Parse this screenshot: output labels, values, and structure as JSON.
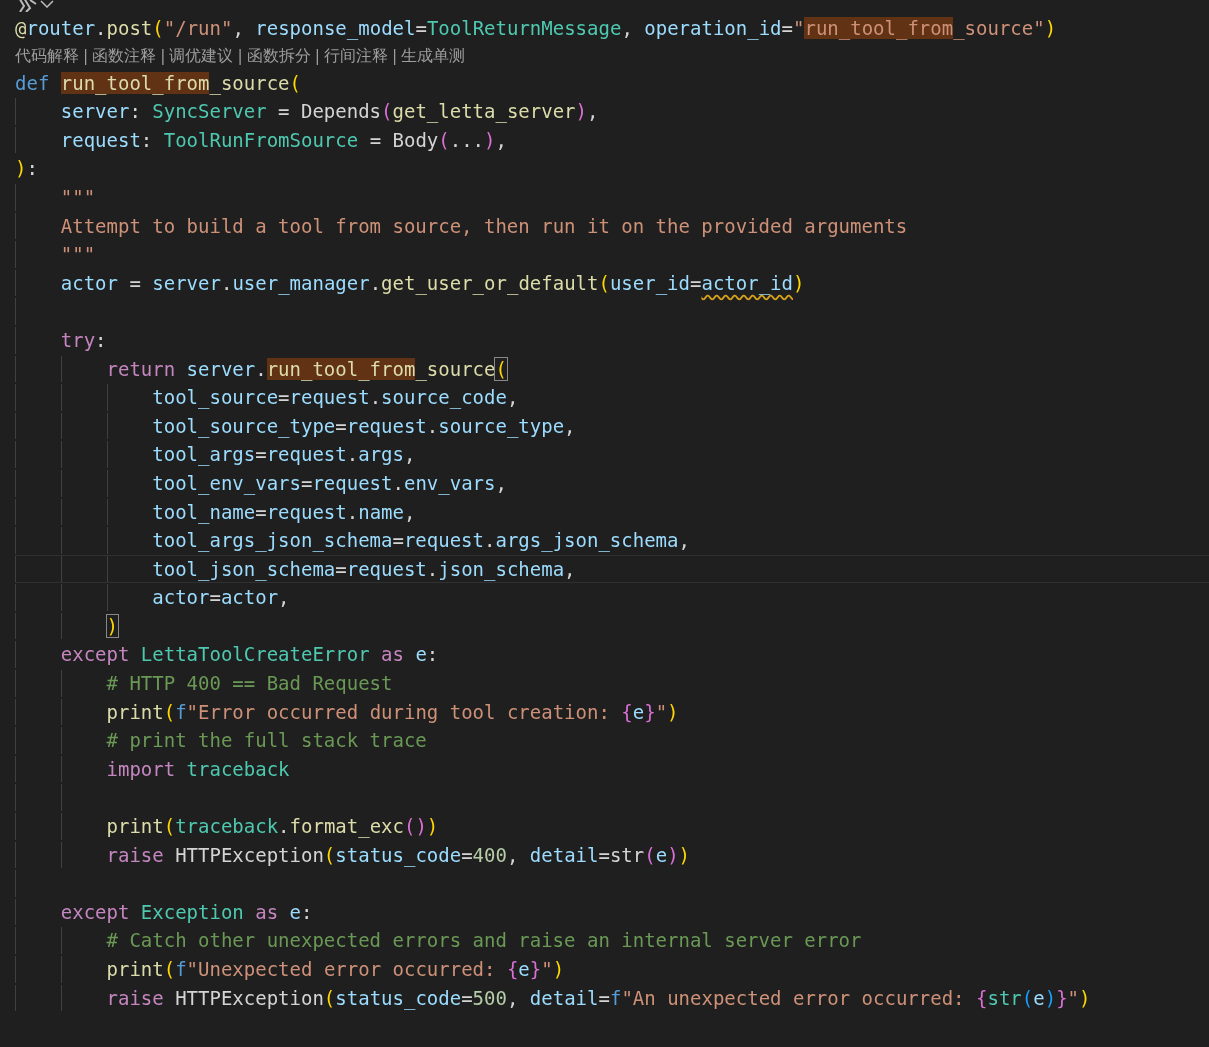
{
  "editor": {
    "lines": [
      {
        "kind": "code",
        "current": false,
        "tokens": [
          {
            "text": "@",
            "kind": "fn"
          },
          {
            "text": "router",
            "kind": "param"
          },
          {
            "text": ".",
            "kind": "plain"
          },
          {
            "text": "post",
            "kind": "fn"
          },
          {
            "text": "(",
            "kind": "br1"
          },
          {
            "text": "\"/run\"",
            "kind": "str"
          },
          {
            "text": ", ",
            "kind": "plain"
          },
          {
            "text": "response_model",
            "kind": "param"
          },
          {
            "text": "=",
            "kind": "plain"
          },
          {
            "text": "ToolReturnMessage",
            "kind": "type"
          },
          {
            "text": ", ",
            "kind": "plain"
          },
          {
            "text": "operation_id",
            "kind": "param"
          },
          {
            "text": "=",
            "kind": "plain"
          },
          {
            "text": "\"",
            "kind": "str"
          },
          {
            "text": "run_tool_from",
            "kind": "str",
            "highlight": true
          },
          {
            "text": "_source\"",
            "kind": "str"
          },
          {
            "text": ")",
            "kind": "br1"
          }
        ]
      },
      {
        "kind": "codelens",
        "separator": "|",
        "items": [
          "代码解释",
          "函数注释",
          "调优建议",
          "函数拆分",
          "行间注释",
          "生成单测"
        ]
      },
      {
        "kind": "code",
        "current": false,
        "tokens": [
          {
            "text": "def ",
            "kind": "kw"
          },
          {
            "text": "run_tool_from",
            "kind": "fn",
            "highlight": true
          },
          {
            "text": "_source",
            "kind": "fn"
          },
          {
            "text": "(",
            "kind": "br1"
          }
        ],
        "children": [
          {
            "kind": "code",
            "current": false,
            "tokens": [
              {
                "text": "server",
                "kind": "param"
              },
              {
                "text": ": ",
                "kind": "plain"
              },
              {
                "text": "SyncServer",
                "kind": "type"
              },
              {
                "text": " = Depends",
                "kind": "plain"
              },
              {
                "text": "(",
                "kind": "br2"
              },
              {
                "text": "get_letta_server",
                "kind": "fn"
              },
              {
                "text": ")",
                "kind": "br2"
              },
              {
                "text": ",",
                "kind": "plain"
              }
            ]
          },
          {
            "kind": "code",
            "current": false,
            "tokens": [
              {
                "text": "request",
                "kind": "param"
              },
              {
                "text": ": ",
                "kind": "plain"
              },
              {
                "text": "ToolRunFromSource",
                "kind": "type"
              },
              {
                "text": " = Body",
                "kind": "plain"
              },
              {
                "text": "(",
                "kind": "br2"
              },
              {
                "text": "...",
                "kind": "plain"
              },
              {
                "text": ")",
                "kind": "br2"
              },
              {
                "text": ",",
                "kind": "plain"
              }
            ]
          }
        ]
      },
      {
        "kind": "code",
        "current": false,
        "tokens": [
          {
            "text": ")",
            "kind": "br1"
          },
          {
            "text": ":",
            "kind": "plain"
          }
        ],
        "children": [
          {
            "kind": "code",
            "current": false,
            "tokens": [
              {
                "text": "\"\"\"",
                "kind": "str"
              }
            ]
          },
          {
            "kind": "code",
            "current": false,
            "tokens": [
              {
                "text": "Attempt to build a tool from source, then run it on the provided arguments",
                "kind": "str"
              }
            ]
          },
          {
            "kind": "code",
            "current": false,
            "tokens": [
              {
                "text": "\"\"\"",
                "kind": "str"
              }
            ]
          },
          {
            "kind": "code",
            "current": false,
            "tokens": [
              {
                "text": "actor",
                "kind": "param"
              },
              {
                "text": " = ",
                "kind": "plain"
              },
              {
                "text": "server",
                "kind": "param"
              },
              {
                "text": ".",
                "kind": "plain"
              },
              {
                "text": "user_manager",
                "kind": "param"
              },
              {
                "text": ".",
                "kind": "plain"
              },
              {
                "text": "get_user_or_default",
                "kind": "fn"
              },
              {
                "text": "(",
                "kind": "br1"
              },
              {
                "text": "user_id",
                "kind": "param"
              },
              {
                "text": "=",
                "kind": "plain"
              },
              {
                "text": "actor_id",
                "kind": "param",
                "squiggle": true
              },
              {
                "text": ")",
                "kind": "br1"
              }
            ]
          },
          {
            "kind": "blank"
          },
          {
            "kind": "code",
            "current": false,
            "tokens": [
              {
                "text": "try",
                "kind": "ctrl"
              },
              {
                "text": ":",
                "kind": "plain"
              }
            ],
            "children": [
              {
                "kind": "code",
                "current": false,
                "tokens": [
                  {
                    "text": "return ",
                    "kind": "ctrl"
                  },
                  {
                    "text": "server",
                    "kind": "param"
                  },
                  {
                    "text": ".",
                    "kind": "plain"
                  },
                  {
                    "text": "run_tool_from",
                    "kind": "fn",
                    "highlight": true
                  },
                  {
                    "text": "_source",
                    "kind": "fn"
                  },
                  {
                    "text": "(",
                    "kind": "br1",
                    "match": true
                  }
                ],
                "children": [
                  {
                    "kind": "code",
                    "current": false,
                    "tokens": [
                      {
                        "text": "tool_source",
                        "kind": "param"
                      },
                      {
                        "text": "=",
                        "kind": "plain"
                      },
                      {
                        "text": "request",
                        "kind": "param"
                      },
                      {
                        "text": ".",
                        "kind": "plain"
                      },
                      {
                        "text": "source_code",
                        "kind": "param"
                      },
                      {
                        "text": ",",
                        "kind": "plain"
                      }
                    ]
                  },
                  {
                    "kind": "code",
                    "current": false,
                    "tokens": [
                      {
                        "text": "tool_source_type",
                        "kind": "param"
                      },
                      {
                        "text": "=",
                        "kind": "plain"
                      },
                      {
                        "text": "request",
                        "kind": "param"
                      },
                      {
                        "text": ".",
                        "kind": "plain"
                      },
                      {
                        "text": "source_type",
                        "kind": "param"
                      },
                      {
                        "text": ",",
                        "kind": "plain"
                      }
                    ]
                  },
                  {
                    "kind": "code",
                    "current": false,
                    "tokens": [
                      {
                        "text": "tool_args",
                        "kind": "param"
                      },
                      {
                        "text": "=",
                        "kind": "plain"
                      },
                      {
                        "text": "request",
                        "kind": "param"
                      },
                      {
                        "text": ".",
                        "kind": "plain"
                      },
                      {
                        "text": "args",
                        "kind": "param"
                      },
                      {
                        "text": ",",
                        "kind": "plain"
                      }
                    ]
                  },
                  {
                    "kind": "code",
                    "current": false,
                    "tokens": [
                      {
                        "text": "tool_env_vars",
                        "kind": "param"
                      },
                      {
                        "text": "=",
                        "kind": "plain"
                      },
                      {
                        "text": "request",
                        "kind": "param"
                      },
                      {
                        "text": ".",
                        "kind": "plain"
                      },
                      {
                        "text": "env_vars",
                        "kind": "param"
                      },
                      {
                        "text": ",",
                        "kind": "plain"
                      }
                    ]
                  },
                  {
                    "kind": "code",
                    "current": false,
                    "tokens": [
                      {
                        "text": "tool_name",
                        "kind": "param"
                      },
                      {
                        "text": "=",
                        "kind": "plain"
                      },
                      {
                        "text": "request",
                        "kind": "param"
                      },
                      {
                        "text": ".",
                        "kind": "plain"
                      },
                      {
                        "text": "name",
                        "kind": "param"
                      },
                      {
                        "text": ",",
                        "kind": "plain"
                      }
                    ]
                  },
                  {
                    "kind": "code",
                    "current": false,
                    "tokens": [
                      {
                        "text": "tool_args_json_schema",
                        "kind": "param"
                      },
                      {
                        "text": "=",
                        "kind": "plain"
                      },
                      {
                        "text": "request",
                        "kind": "param"
                      },
                      {
                        "text": ".",
                        "kind": "plain"
                      },
                      {
                        "text": "args_json_schema",
                        "kind": "param"
                      },
                      {
                        "text": ",",
                        "kind": "plain"
                      }
                    ]
                  },
                  {
                    "kind": "code",
                    "current": true,
                    "tokens": [
                      {
                        "text": "tool_json_schema",
                        "kind": "param"
                      },
                      {
                        "text": "=",
                        "kind": "plain"
                      },
                      {
                        "text": "request",
                        "kind": "param"
                      },
                      {
                        "text": ".",
                        "kind": "plain"
                      },
                      {
                        "text": "json_schema",
                        "kind": "param"
                      },
                      {
                        "text": ",",
                        "kind": "plain"
                      }
                    ]
                  },
                  {
                    "kind": "code",
                    "current": false,
                    "tokens": [
                      {
                        "text": "actor",
                        "kind": "param"
                      },
                      {
                        "text": "=",
                        "kind": "plain"
                      },
                      {
                        "text": "actor",
                        "kind": "param"
                      },
                      {
                        "text": ",",
                        "kind": "plain"
                      }
                    ]
                  }
                ]
              },
              {
                "kind": "code",
                "current": false,
                "tokens": [
                  {
                    "text": ")",
                    "kind": "br1",
                    "match": true
                  }
                ]
              }
            ]
          },
          {
            "kind": "code",
            "current": false,
            "tokens": [
              {
                "text": "except ",
                "kind": "ctrl"
              },
              {
                "text": "LettaToolCreateError ",
                "kind": "type"
              },
              {
                "text": "as ",
                "kind": "ctrl"
              },
              {
                "text": "e",
                "kind": "param"
              },
              {
                "text": ":",
                "kind": "plain"
              }
            ],
            "children": [
              {
                "kind": "code",
                "current": false,
                "tokens": [
                  {
                    "text": "# HTTP 400 == Bad Request",
                    "kind": "comment"
                  }
                ]
              },
              {
                "kind": "code",
                "current": false,
                "tokens": [
                  {
                    "text": "print",
                    "kind": "fn"
                  },
                  {
                    "text": "(",
                    "kind": "br1"
                  },
                  {
                    "text": "f",
                    "kind": "kw"
                  },
                  {
                    "text": "\"Error occurred during tool creation: ",
                    "kind": "str"
                  },
                  {
                    "text": "{",
                    "kind": "br2"
                  },
                  {
                    "text": "e",
                    "kind": "param"
                  },
                  {
                    "text": "}",
                    "kind": "br2"
                  },
                  {
                    "text": "\"",
                    "kind": "str"
                  },
                  {
                    "text": ")",
                    "kind": "br1"
                  }
                ]
              },
              {
                "kind": "code",
                "current": false,
                "tokens": [
                  {
                    "text": "# print the full stack trace",
                    "kind": "comment"
                  }
                ]
              },
              {
                "kind": "code",
                "current": false,
                "tokens": [
                  {
                    "text": "import ",
                    "kind": "ctrl"
                  },
                  {
                    "text": "traceback",
                    "kind": "type"
                  }
                ]
              },
              {
                "kind": "blank"
              },
              {
                "kind": "code",
                "current": false,
                "tokens": [
                  {
                    "text": "print",
                    "kind": "fn"
                  },
                  {
                    "text": "(",
                    "kind": "br1"
                  },
                  {
                    "text": "traceback",
                    "kind": "type"
                  },
                  {
                    "text": ".",
                    "kind": "plain"
                  },
                  {
                    "text": "format_exc",
                    "kind": "fn"
                  },
                  {
                    "text": "()",
                    "kind": "br2"
                  },
                  {
                    "text": ")",
                    "kind": "br1"
                  }
                ]
              },
              {
                "kind": "code",
                "current": false,
                "tokens": [
                  {
                    "text": "raise",
                    "kind": "ctrl"
                  },
                  {
                    "text": " HTTPException",
                    "kind": "plain"
                  },
                  {
                    "text": "(",
                    "kind": "br1"
                  },
                  {
                    "text": "status_code",
                    "kind": "param"
                  },
                  {
                    "text": "=",
                    "kind": "plain"
                  },
                  {
                    "text": "400",
                    "kind": "num"
                  },
                  {
                    "text": ", ",
                    "kind": "plain"
                  },
                  {
                    "text": "detail",
                    "kind": "param"
                  },
                  {
                    "text": "=str",
                    "kind": "plain"
                  },
                  {
                    "text": "(",
                    "kind": "br2"
                  },
                  {
                    "text": "e",
                    "kind": "param"
                  },
                  {
                    "text": ")",
                    "kind": "br2"
                  },
                  {
                    "text": ")",
                    "kind": "br1"
                  }
                ]
              }
            ]
          },
          {
            "kind": "blank"
          },
          {
            "kind": "code",
            "current": false,
            "tokens": [
              {
                "text": "except ",
                "kind": "ctrl"
              },
              {
                "text": "Exception ",
                "kind": "type"
              },
              {
                "text": "as ",
                "kind": "ctrl"
              },
              {
                "text": "e",
                "kind": "param"
              },
              {
                "text": ":",
                "kind": "plain"
              }
            ],
            "children": [
              {
                "kind": "code",
                "current": false,
                "tokens": [
                  {
                    "text": "# Catch other unexpected errors and raise an internal server error",
                    "kind": "comment"
                  }
                ]
              },
              {
                "kind": "code",
                "current": false,
                "tokens": [
                  {
                    "text": "print",
                    "kind": "fn"
                  },
                  {
                    "text": "(",
                    "kind": "br1"
                  },
                  {
                    "text": "f",
                    "kind": "kw"
                  },
                  {
                    "text": "\"Unexpected error occurred: ",
                    "kind": "str"
                  },
                  {
                    "text": "{",
                    "kind": "br2"
                  },
                  {
                    "text": "e",
                    "kind": "param"
                  },
                  {
                    "text": "}",
                    "kind": "br2"
                  },
                  {
                    "text": "\"",
                    "kind": "str"
                  },
                  {
                    "text": ")",
                    "kind": "br1"
                  }
                ]
              },
              {
                "kind": "code",
                "current": false,
                "tokens": [
                  {
                    "text": "raise",
                    "kind": "ctrl"
                  },
                  {
                    "text": " HTTPException",
                    "kind": "plain"
                  },
                  {
                    "text": "(",
                    "kind": "br1"
                  },
                  {
                    "text": "status_code",
                    "kind": "param"
                  },
                  {
                    "text": "=",
                    "kind": "plain"
                  },
                  {
                    "text": "500",
                    "kind": "num"
                  },
                  {
                    "text": ", ",
                    "kind": "plain"
                  },
                  {
                    "text": "detail",
                    "kind": "param"
                  },
                  {
                    "text": "=",
                    "kind": "plain"
                  },
                  {
                    "text": "f",
                    "kind": "kw"
                  },
                  {
                    "text": "\"An unexpected error occurred: ",
                    "kind": "str"
                  },
                  {
                    "text": "{",
                    "kind": "br2"
                  },
                  {
                    "text": "str",
                    "kind": "type"
                  },
                  {
                    "text": "(",
                    "kind": "br3"
                  },
                  {
                    "text": "e",
                    "kind": "param"
                  },
                  {
                    "text": ")",
                    "kind": "br3"
                  },
                  {
                    "text": "}",
                    "kind": "br2"
                  },
                  {
                    "text": "\"",
                    "kind": "str"
                  },
                  {
                    "text": ")",
                    "kind": "br1"
                  }
                ]
              }
            ]
          }
        ]
      }
    ]
  }
}
